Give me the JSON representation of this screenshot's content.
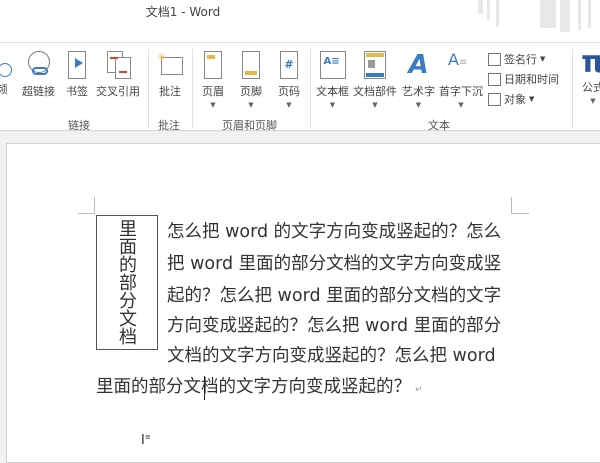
{
  "window": {
    "title": "文档1 - Word"
  },
  "ribbon": {
    "partial_left": "频",
    "groups": [
      {
        "label": "链接",
        "buttons": [
          "超链接",
          "书签",
          "交叉引用"
        ]
      },
      {
        "label": "批注",
        "buttons": [
          "批注"
        ]
      },
      {
        "label": "页眉和页脚",
        "buttons": [
          "页眉",
          "页脚",
          "页码"
        ]
      },
      {
        "label": "文本",
        "buttons": [
          "文本框",
          "文档部件",
          "艺术字",
          "首字下沉"
        ],
        "small": [
          "签名行",
          "日期和时间",
          "对象"
        ]
      }
    ],
    "partial_right": "公式"
  },
  "document": {
    "textbox": "里面的部分文档",
    "lines": [
      "怎么把 word 的文字方向变成竖起的？怎么",
      "把 word 里面的部分文档的文字方向变成竖",
      "起的？怎么把 word 里面的部分文档的文字",
      "方向变成竖起的？怎么把 word 里面的部分",
      "文档的文字方向变成竖起的？怎么把  word"
    ],
    "last_line_before_cursor": "里面的部分文",
    "last_line_after_cursor": "档的文字方向变成竖起的？",
    "paragraph_mark": "↵"
  },
  "colors": {
    "accent": "#2b579a",
    "blue_icon": "#3a7cc4",
    "yellow": "#e8b84a",
    "red": "#d9412c"
  }
}
